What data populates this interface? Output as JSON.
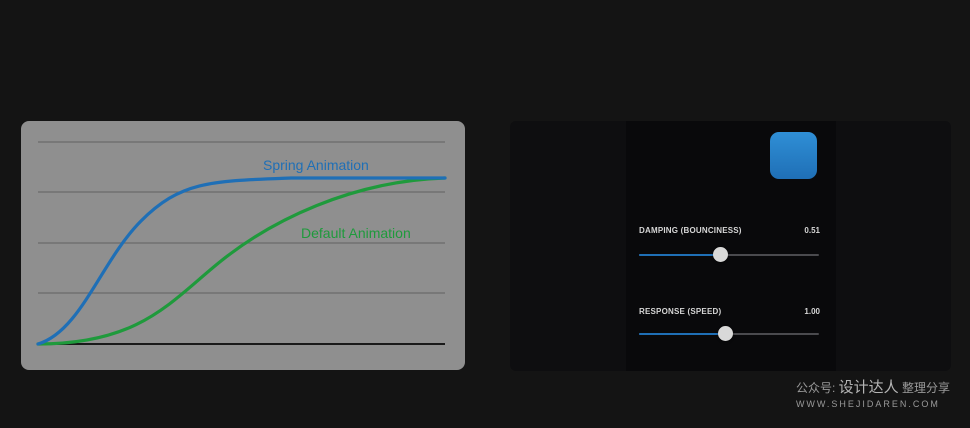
{
  "graph": {
    "spring_label": "Spring Animation",
    "default_label": "Default Animation",
    "colors": {
      "background": "#8f8f8f",
      "spring": "#1f6fb6",
      "default": "#1f9a3c",
      "gridline": "#6b6b6b",
      "baseline": "#1a1a1a"
    }
  },
  "panel": {
    "damping": {
      "label": "DAMPING (BOUNCINESS)",
      "value": "0.51",
      "fraction": 0.45
    },
    "response": {
      "label": "RESPONSE (SPEED)",
      "value": "1.00",
      "fraction": 0.48
    },
    "colors": {
      "accent": "#1f6fb6"
    }
  },
  "watermark": {
    "prefix": "公众号:",
    "brand": "设计达人",
    "suffix": "整理分享",
    "url": "WWW.SHEJIDAREN.COM"
  }
}
